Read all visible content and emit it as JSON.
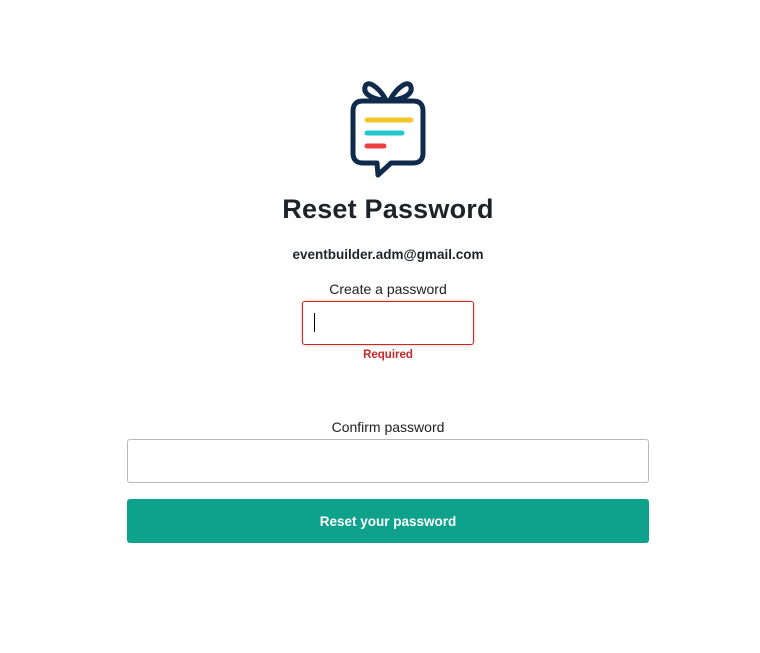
{
  "brand": {
    "logo_icon": "gift-message-logo-icon",
    "colors": {
      "outline": "#102a4c",
      "line1": "#f6c42b",
      "line2": "#21c6cf",
      "line3": "#ef3e3e"
    }
  },
  "page": {
    "title": "Reset Password",
    "email": "eventbuilder.adm@gmail.com"
  },
  "form": {
    "create_label": "Create a password",
    "create_value": "",
    "create_error": "Required",
    "confirm_label": "Confirm password",
    "confirm_value": "",
    "submit_label": "Reset your password"
  },
  "colors": {
    "accent": "#0ea18b",
    "error": "#c62828",
    "text": "#212121"
  }
}
